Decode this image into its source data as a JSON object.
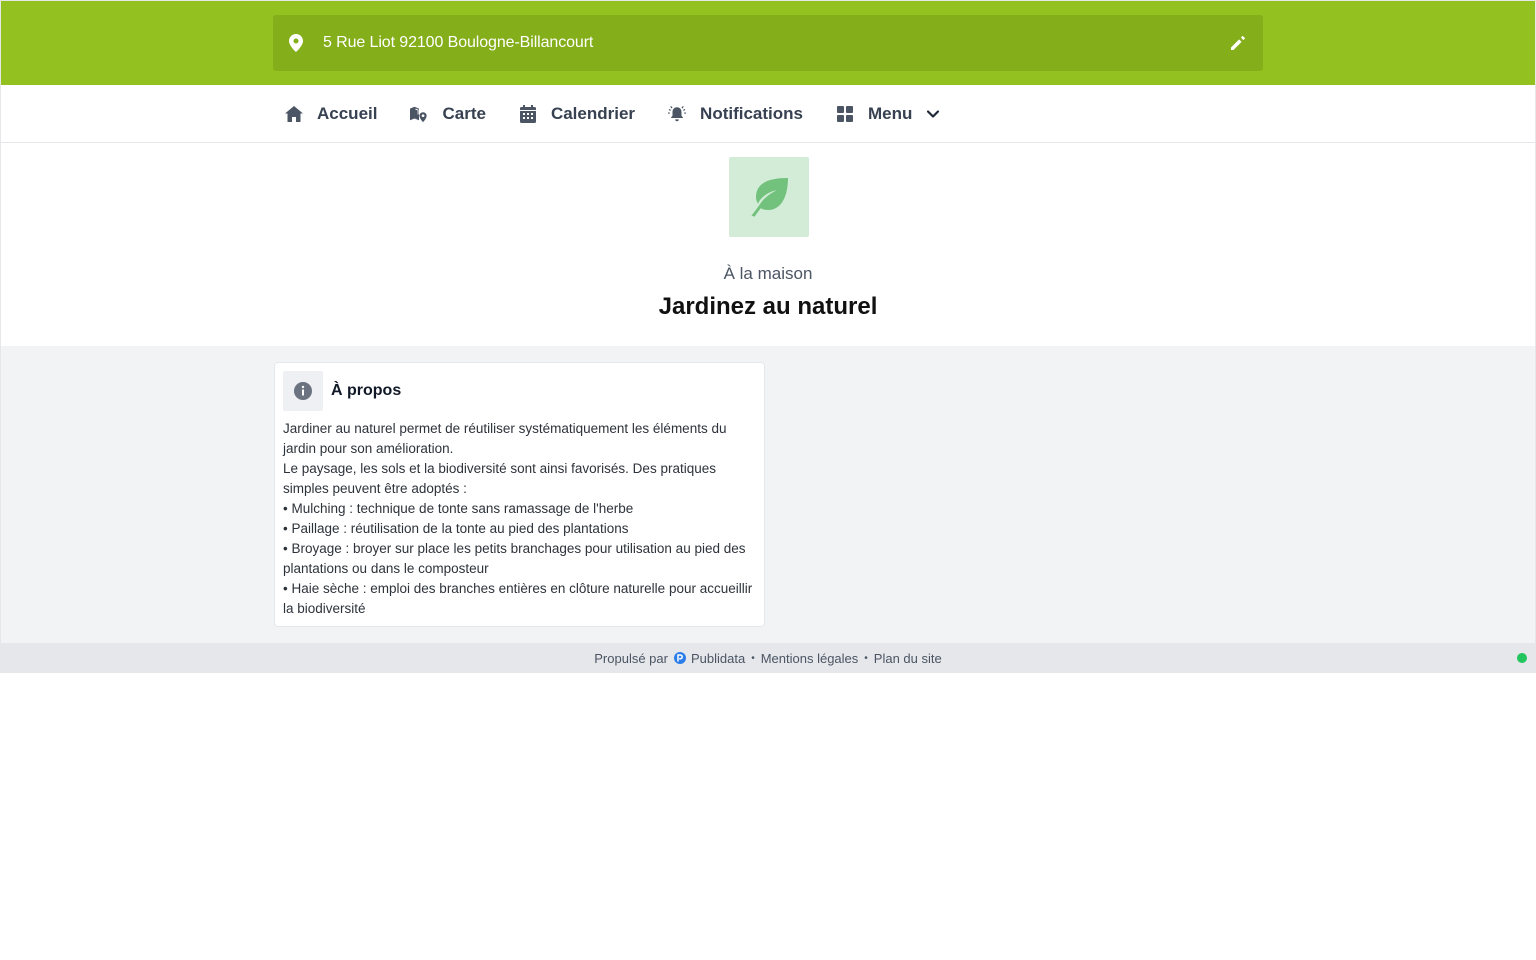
{
  "header": {
    "address": "5 Rue Liot 92100 Boulogne-Billancourt",
    "pin_icon": "map-pin-icon",
    "edit_icon": "pencil-icon",
    "brand_color": "#93c11f"
  },
  "nav": {
    "items": [
      {
        "label": "Accueil",
        "icon": "home-icon"
      },
      {
        "label": "Carte",
        "icon": "map-marker-icon"
      },
      {
        "label": "Calendrier",
        "icon": "calendar-icon"
      },
      {
        "label": "Notifications",
        "icon": "bell-icon"
      },
      {
        "label": "Menu",
        "icon": "grid-icon",
        "has_dropdown": true
      }
    ]
  },
  "hero": {
    "icon": "leaf-icon",
    "category": "À la maison",
    "title": "Jardinez au naturel"
  },
  "about": {
    "icon": "info-icon",
    "title": "À propos",
    "lines": [
      "Jardiner au naturel permet de réutiliser systématiquement les éléments du jardin pour son amélioration.",
      "Le paysage, les sols et la biodiversité sont ainsi favorisés. Des pratiques simples peuvent être adoptés :",
      "• Mulching : technique de tonte sans ramassage de l'herbe",
      "• Paillage : réutilisation de la tonte au pied des plantations",
      "• Broyage : broyer sur place les petits branchages pour utilisation au pied des plantations ou dans le composteur",
      "• Haie sèche : emploi des branches entières en clôture naturelle pour accueillir la biodiversité"
    ]
  },
  "footer": {
    "powered_by": "Propulsé par",
    "brand": "Publidata",
    "legal": "Mentions légales",
    "sitemap": "Plan du site",
    "separator": "•",
    "status_color": "#22c55e"
  }
}
